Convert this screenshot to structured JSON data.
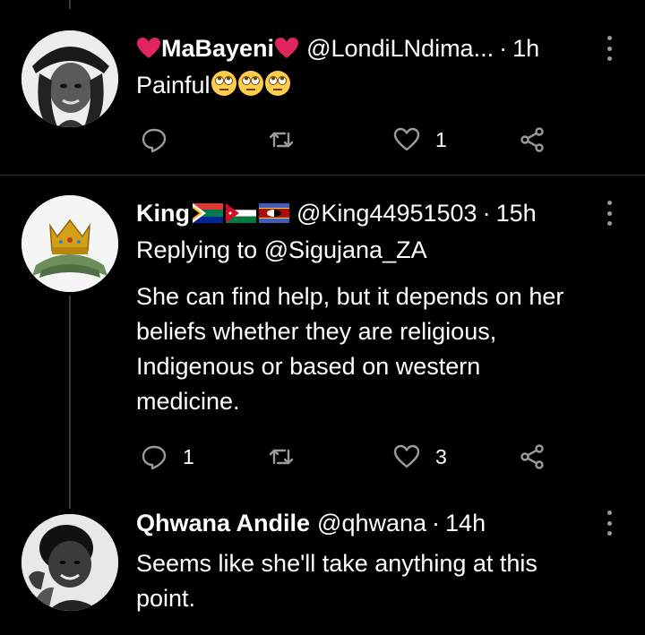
{
  "tweets": [
    {
      "name": "MaBayeni",
      "handle": "@LondiLNdima...",
      "separator": "·",
      "time": "1h",
      "text": "Painful",
      "emojis": [
        "face-with-rolling-eyes",
        "face-with-rolling-eyes",
        "face-with-rolling-eyes"
      ],
      "name_decoration": "red-heart",
      "reply_count": "",
      "retweet_count": "",
      "like_count": "1"
    },
    {
      "name": "King",
      "handle": "@King44951503",
      "separator": "·",
      "time": "15h",
      "flags": [
        "south-africa-flag",
        "jordan-flag",
        "eswatini-flag"
      ],
      "replying_to": "Replying to @Sigujana_ZA",
      "text_lines": [
        "She can find help, but it depends on her",
        "beliefs whether they are religious,",
        "Indigenous or based on western",
        "medicine."
      ],
      "reply_count": "1",
      "retweet_count": "",
      "like_count": "3"
    },
    {
      "name": "Qhwana Andile",
      "handle": "@qhwana",
      "separator": "·",
      "time": "14h",
      "text_lines": [
        "Seems like she'll take anything at this",
        "point."
      ]
    }
  ],
  "icons": {
    "reply": "reply-icon",
    "retweet": "retweet-icon",
    "like": "heart-outline-icon",
    "share": "share-icon",
    "more": "more-vertical-icon"
  },
  "colors": {
    "background": "#000000",
    "text": "#ffffff",
    "icon": "#9a9a9a",
    "heart": "#e0245e",
    "emoji": "#ffcc4d"
  }
}
